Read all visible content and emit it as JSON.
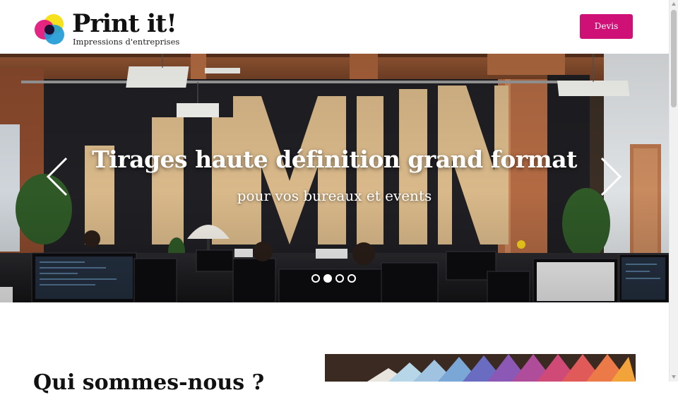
{
  "header": {
    "brand_name": "Print it!",
    "brand_tagline": "Impressions d'entreprises",
    "logo_icon": "cmyk-circles-icon",
    "cta_label": "Devis"
  },
  "hero": {
    "title": "Tirages haute définition grand format",
    "subtitle": "pour vos bureaux et events",
    "prev_icon": "chevron-left-icon",
    "next_icon": "chevron-right-icon",
    "slide_count": 4,
    "active_slide": 2,
    "wall_mural_text": "CICMUN"
  },
  "section": {
    "heading": "Qui sommes-nous ?"
  },
  "colors": {
    "accent": "#cf1177",
    "logo_yellow": "#f7e11c",
    "logo_magenta": "#e3197c",
    "logo_cyan": "#1c9ad6"
  }
}
